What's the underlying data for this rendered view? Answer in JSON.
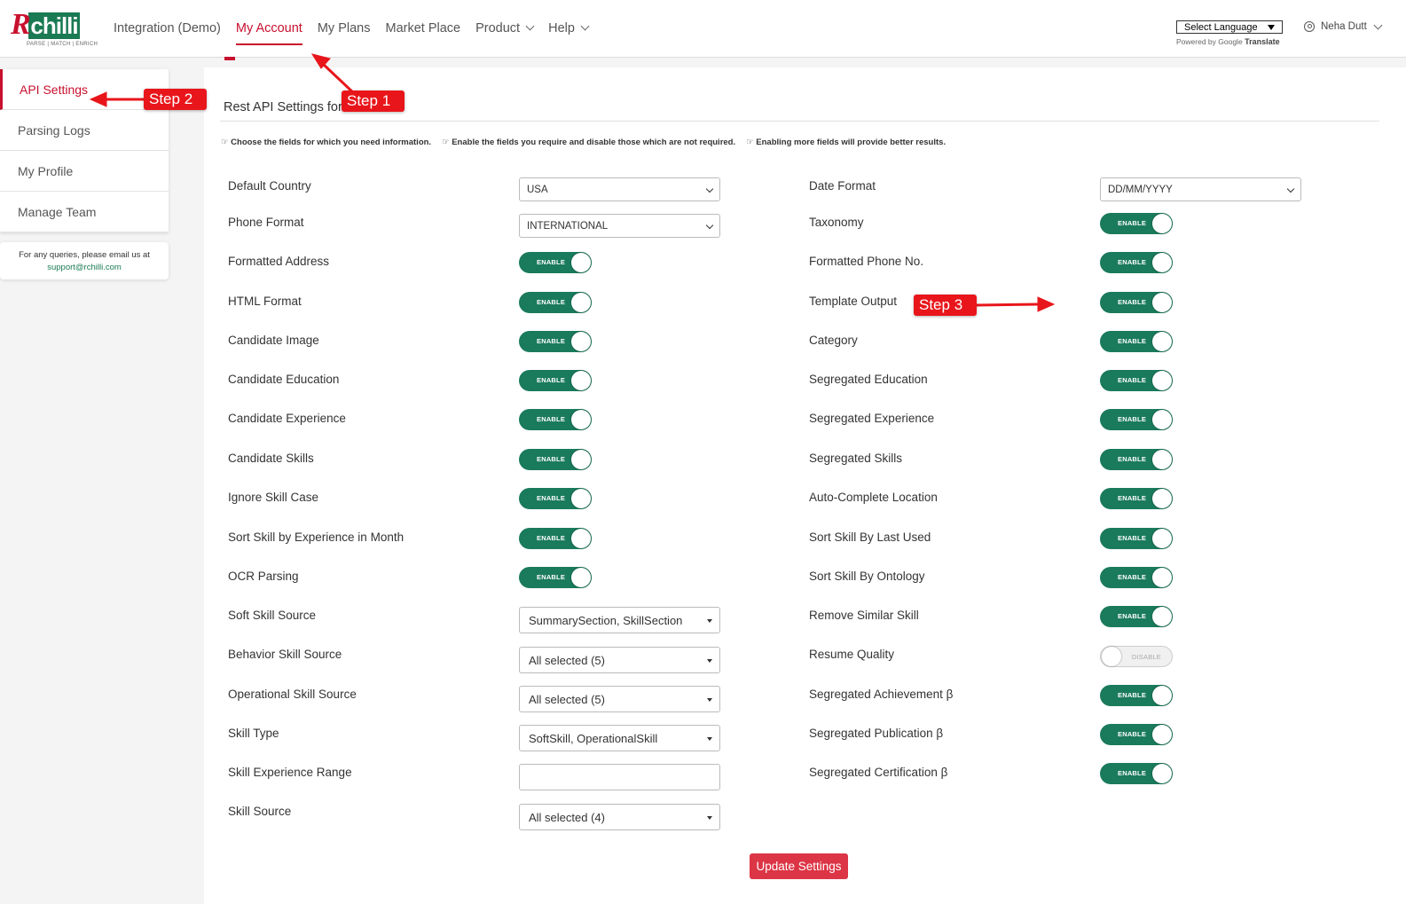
{
  "brand": {
    "logo_text": "R",
    "logo_box": "chilli",
    "tagline": "PARSE | MATCH | ENRICH",
    "accent_color": "#c8102e",
    "green_color": "#1a7a5c"
  },
  "nav": {
    "items": [
      {
        "label": "Integration (Demo)"
      },
      {
        "label": "My Account"
      },
      {
        "label": "My Plans"
      },
      {
        "label": "Market Place"
      },
      {
        "label": "Product"
      },
      {
        "label": "Help"
      }
    ]
  },
  "translate": {
    "select_label": "Select Language",
    "powered_prefix": "Powered by",
    "google": "Google",
    "translate_word": "Translate"
  },
  "user": {
    "name": "Neha Dutt"
  },
  "sidebar": {
    "items": [
      {
        "label": "API Settings"
      },
      {
        "label": "Parsing Logs"
      },
      {
        "label": "My Profile"
      },
      {
        "label": "Manage Team"
      }
    ],
    "support_text": "For any queries, please email us at",
    "support_email": "support@rchilli.com"
  },
  "panel": {
    "title": "Rest API Settings for",
    "hints": [
      "☞ Choose the fields for which you need information.",
      "☞ Enable the fields you require and disable those which are not required.",
      "☞ Enabling more fields will provide better results."
    ]
  },
  "left_fields": [
    {
      "label": "Default Country",
      "value": "USA"
    },
    {
      "label": "Phone Format",
      "value": "INTERNATIONAL"
    },
    {
      "label": "Formatted Address",
      "value": "ENABLE"
    },
    {
      "label": "HTML Format",
      "value": "ENABLE"
    },
    {
      "label": "Candidate Image",
      "value": "ENABLE"
    },
    {
      "label": "Candidate Education",
      "value": "ENABLE"
    },
    {
      "label": "Candidate Experience",
      "value": "ENABLE"
    },
    {
      "label": "Candidate Skills",
      "value": "ENABLE"
    },
    {
      "label": "Ignore Skill Case",
      "value": "ENABLE"
    },
    {
      "label": "Sort Skill by Experience in Month",
      "value": "ENABLE"
    },
    {
      "label": "OCR Parsing",
      "value": "ENABLE"
    },
    {
      "label": "Soft Skill Source",
      "value": "SummarySection, SkillSection"
    },
    {
      "label": "Behavior Skill Source",
      "value": "All selected (5)"
    },
    {
      "label": "Operational Skill Source",
      "value": "All selected (5)"
    },
    {
      "label": "Skill Type",
      "value": "SoftSkill, OperationalSkill"
    },
    {
      "label": "Skill Experience Range",
      "value": ""
    },
    {
      "label": "Skill Source",
      "value": "All selected (4)"
    }
  ],
  "right_fields": [
    {
      "label": "Date Format",
      "value": "DD/MM/YYYY"
    },
    {
      "label": "Taxonomy",
      "value": "ENABLE"
    },
    {
      "label": "Formatted Phone No.",
      "value": "ENABLE"
    },
    {
      "label": "Template Output",
      "value": "ENABLE"
    },
    {
      "label": "Category",
      "value": "ENABLE"
    },
    {
      "label": "Segregated Education",
      "value": "ENABLE"
    },
    {
      "label": "Segregated Experience",
      "value": "ENABLE"
    },
    {
      "label": "Segregated Skills",
      "value": "ENABLE"
    },
    {
      "label": "Auto-Complete Location",
      "value": "ENABLE"
    },
    {
      "label": "Sort Skill By Last Used",
      "value": "ENABLE"
    },
    {
      "label": "Sort Skill By Ontology",
      "value": "ENABLE"
    },
    {
      "label": "Remove Similar Skill",
      "value": "ENABLE"
    },
    {
      "label": "Resume Quality",
      "value": "DISABLE"
    },
    {
      "label": "Segregated Achievement β",
      "value": "ENABLE"
    },
    {
      "label": "Segregated Publication β",
      "value": "ENABLE"
    },
    {
      "label": "Segregated Certification β",
      "value": "ENABLE"
    }
  ],
  "update_button": "Update Settings",
  "callouts": {
    "step1": "Step 1",
    "step2": "Step 2",
    "step3": "Step 3"
  }
}
